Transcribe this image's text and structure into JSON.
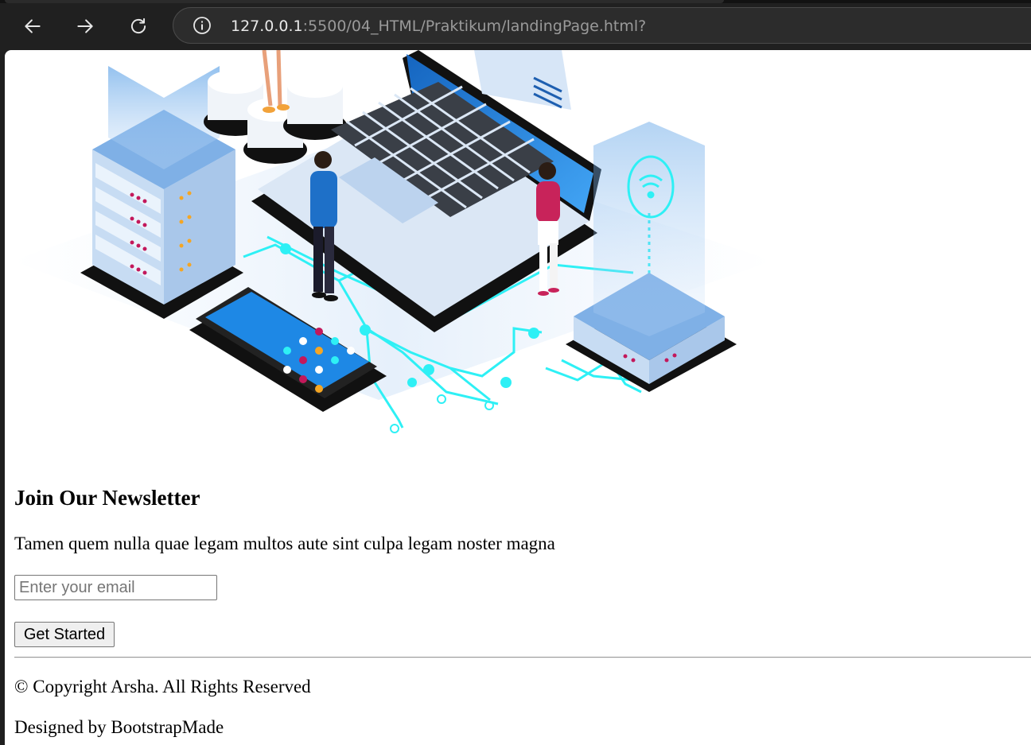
{
  "browser": {
    "url_host": "127.0.0.1",
    "url_path": ":5500/04_HTML/Praktikum/landingPage.html?",
    "icons": [
      "back-arrow-icon",
      "forward-arrow-icon",
      "reload-icon",
      "site-info-icon"
    ]
  },
  "hero": {
    "image_subject": "isometric-tech-illustration"
  },
  "newsletter": {
    "title": "Join Our Newsletter",
    "description": "Tamen quem nulla quae legam multos aute sint culpa legam noster magna",
    "email_placeholder": "Enter your email",
    "email_value": "",
    "button_label": "Get Started"
  },
  "footer": {
    "copyright": "© Copyright Arsha. All Rights Reserved",
    "credits": "Designed by BootstrapMade"
  },
  "colors": {
    "chrome_bg": "#202020",
    "omnibox_bg": "#2c2c2c",
    "page_bg": "#ffffff",
    "circuit_cyan": "#2ef0f5",
    "server_blue": "#8fb8ea",
    "laptop_screen": "#1976d2"
  }
}
